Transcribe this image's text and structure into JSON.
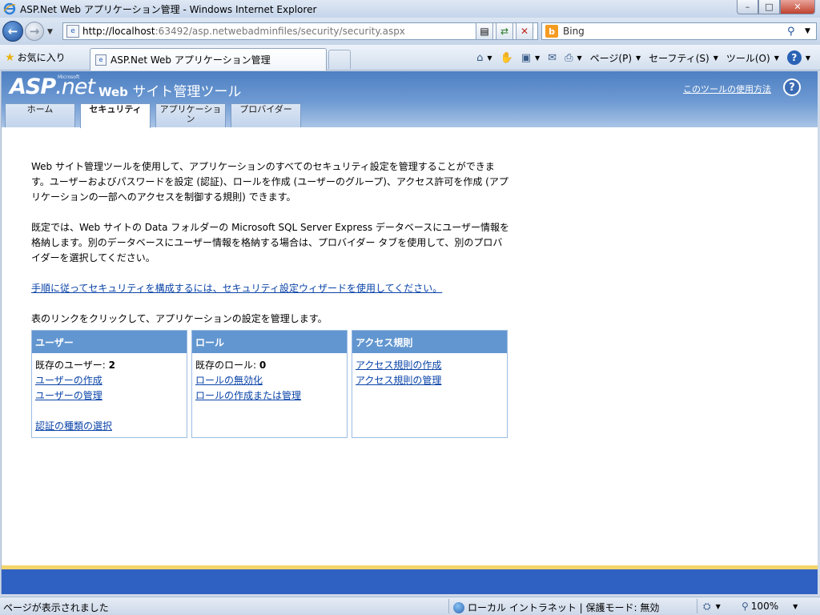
{
  "window": {
    "title": "ASP.Net Web アプリケーション管理 - Windows Internet Explorer",
    "minimize": "–",
    "maximize": "□",
    "close": "✕"
  },
  "address": {
    "url_host": "http://localhost",
    "url_rest": ":63492/asp.netwebadminfiles/security/security.aspx",
    "search_text": "Bing"
  },
  "favorites": {
    "label": "お気に入り"
  },
  "tab": {
    "title": "ASP.Net Web アプリケーション管理"
  },
  "commands": {
    "page": "ページ(P)",
    "safety": "セーフティ(S)",
    "tools": "ツール(O)"
  },
  "site": {
    "logo_asp": "ASP",
    "logo_net": ".net",
    "logo_ms": "Microsoft",
    "title_web": "Web",
    "title_rest": " サイト管理ツール",
    "help_link": "このツールの使用方法",
    "help_icon": "?"
  },
  "page_tabs": [
    {
      "label": "ホーム",
      "active": false
    },
    {
      "label": "セキュリティ",
      "active": true
    },
    {
      "label": "アプリケーション",
      "active": false
    },
    {
      "label": "プロバイダー",
      "active": false
    }
  ],
  "content": {
    "para1": "Web サイト管理ツールを使用して、アプリケーションのすべてのセキュリティ設定を管理することができます。ユーザーおよびパスワードを設定 (認証)、ロールを作成 (ユーザーのグループ)、アクセス許可を作成 (アプリケーションの一部へのアクセスを制御する規則) できます。",
    "para2": "既定では、Web サイトの Data フォルダーの Microsoft SQL Server Express データベースにユーザー情報を格納します。別のデータベースにユーザー情報を格納する場合は、プロバイダー タブを使用して、別のプロバイダーを選択してください。",
    "wizard_link": "手順に従ってセキュリティを構成するには、セキュリティ設定ウィザードを使用してください。",
    "table_intro": "表のリンクをクリックして、アプリケーションの設定を管理します。"
  },
  "grid": {
    "users": {
      "header": "ユーザー",
      "existing_label": "既存のユーザー: ",
      "existing_count": "2",
      "create": "ユーザーの作成",
      "manage": "ユーザーの管理",
      "auth_type": "認証の種類の選択"
    },
    "roles": {
      "header": "ロール",
      "existing_label": "既存のロール: ",
      "existing_count": "0",
      "disable": "ロールの無効化",
      "create_manage": "ロールの作成または管理"
    },
    "access": {
      "header": "アクセス規則",
      "create": "アクセス規則の作成",
      "manage": "アクセス規則の管理"
    }
  },
  "status": {
    "text": "ページが表示されました",
    "zone": "ローカル イントラネット | 保護モード: 無効",
    "zoom": "100%"
  },
  "colors": {
    "header_blue": "#4d7fc2",
    "grid_header": "#6296d0",
    "link": "#0b44a8",
    "footer_blue": "#2f61c2",
    "footer_yellow": "#f4d56a"
  }
}
